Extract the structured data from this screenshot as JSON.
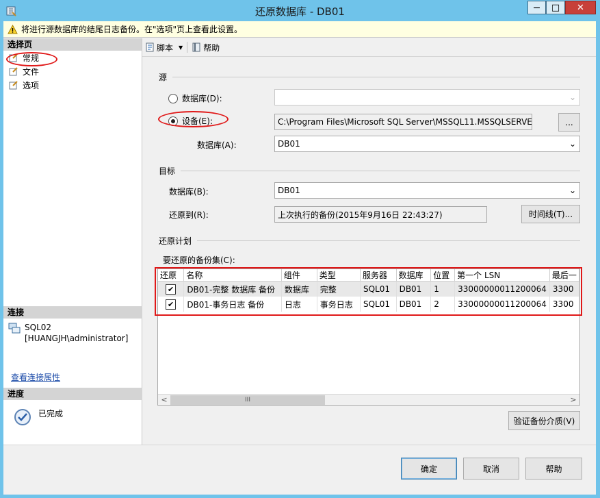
{
  "window": {
    "title": "还原数据库 - DB01",
    "controls": {
      "minimize": "—",
      "maximize": "□",
      "close": "✕"
    }
  },
  "infobar": {
    "icon": "warning-icon",
    "text": "将进行源数据库的结尾日志备份。在\"选项\"页上查看此设置。"
  },
  "left_pane": {
    "select_page_header": "选择页",
    "pages": [
      {
        "label": "常规",
        "icon": "page-icon"
      },
      {
        "label": "文件",
        "icon": "page-icon"
      },
      {
        "label": "选项",
        "icon": "page-icon"
      }
    ],
    "connection_header": "连接",
    "server": "SQL02",
    "user": "[HUANGJH\\administrator]",
    "view_connection_link": "查看连接属性",
    "progress_header": "进度",
    "progress_status": "已完成"
  },
  "toolbar": {
    "script_label": "脚本",
    "help_label": "帮助"
  },
  "source": {
    "group_label": "源",
    "database_radio_label": "数据库(D):",
    "database_value": "",
    "device_radio_label": "设备(E):",
    "device_value": "C:\\Program Files\\Microsoft SQL Server\\MSSQL11.MSSQLSERVER",
    "browse_label": "...",
    "db_label": "数据库(A):",
    "db_value": "DB01"
  },
  "target": {
    "group_label": "目标",
    "db_label": "数据库(B):",
    "db_value": "DB01",
    "restore_to_label": "还原到(R):",
    "restore_to_value": "上次执行的备份(2015年9月16日 22:43:27)",
    "timeline_label": "时间线(T)..."
  },
  "plan": {
    "group_label": "还原计划",
    "sets_label": "要还原的备份集(C):",
    "columns": [
      "还原",
      "名称",
      "组件",
      "类型",
      "服务器",
      "数据库",
      "位置",
      "第一个 LSN",
      "最后一"
    ],
    "rows": [
      {
        "restore": true,
        "name": "DB01-完整 数据库 备份",
        "component": "数据库",
        "type": "完整",
        "server": "SQL01",
        "database": "DB01",
        "position": "1",
        "first_lsn": "33000000011200064",
        "last_lsn": "3300"
      },
      {
        "restore": true,
        "name": "DB01-事务日志  备份",
        "component": "日志",
        "type": "事务日志",
        "server": "SQL01",
        "database": "DB01",
        "position": "2",
        "first_lsn": "33000000011200064",
        "last_lsn": "3300"
      }
    ],
    "scroll_left": "<",
    "scroll_thumb": "III",
    "scroll_right": ">",
    "verify_label": "验证备份介质(V)"
  },
  "buttons": {
    "ok": "确定",
    "cancel": "取消",
    "help": "帮助"
  }
}
